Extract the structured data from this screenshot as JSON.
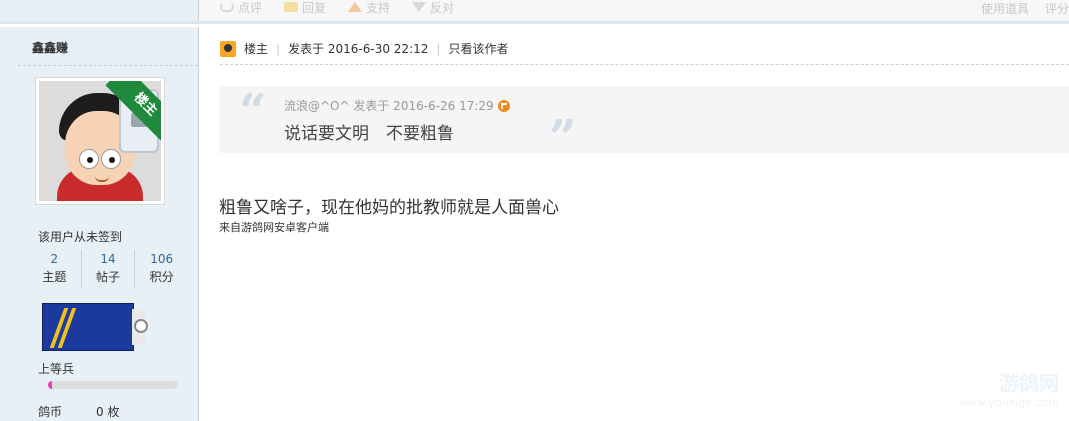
{
  "toolbar": {
    "actions": [
      {
        "label": "点评",
        "icon": "comment-icon"
      },
      {
        "label": "回复",
        "icon": "reply-icon"
      },
      {
        "label": "支持",
        "icon": "thumb-up-icon"
      },
      {
        "label": "反对",
        "icon": "thumb-down-icon"
      }
    ],
    "right": [
      "使用道具",
      "评分"
    ]
  },
  "sidebar": {
    "username": "鑫鑫赚",
    "badge": "楼主",
    "signin": "该用户从未签到",
    "stats": [
      {
        "num": "2",
        "label": "主题"
      },
      {
        "num": "14",
        "label": "帖子"
      },
      {
        "num": "106",
        "label": "积分"
      }
    ],
    "rank": "上等兵",
    "rank_progress": 0.03,
    "coins_label": "鸽币",
    "coins_value": "0 枚"
  },
  "post": {
    "owner": "楼主",
    "posted": "发表于 2016-6-30 22:12",
    "only_author": "只看该作者",
    "quote_meta": "流浪@^O^ 发表于 2016-6-26 17:29",
    "quote_text": "说话要文明　不要粗鲁",
    "body": "粗鲁又啥子，现在他妈的批教师就是人面兽心",
    "source": "来自游鸽网安卓客户端"
  },
  "watermark": {
    "line1": "游鸽网",
    "line2": "www.youxige.com"
  },
  "colors": {
    "sidebar_bg": "#e8f0f7",
    "badge_green": "#1f8a3c",
    "link_blue": "#336699",
    "progress_pink": "#e63fb0"
  }
}
